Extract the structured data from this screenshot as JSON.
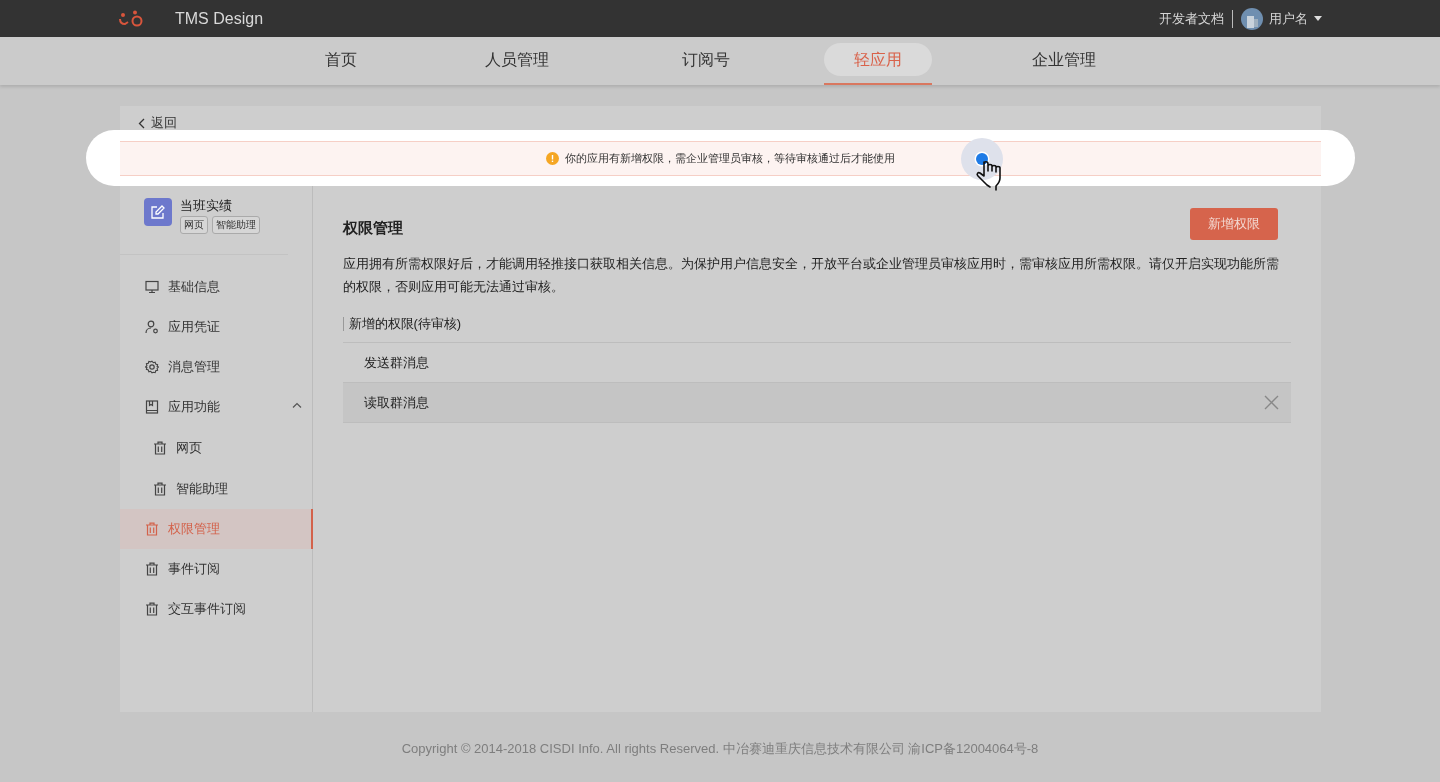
{
  "header": {
    "brand": "TMS Design",
    "docs_link": "开发者文档",
    "username": "用户名"
  },
  "nav": [
    {
      "label": "首页",
      "selected": false
    },
    {
      "label": "人员管理",
      "selected": false
    },
    {
      "label": "订阅号",
      "selected": false
    },
    {
      "label": "轻应用",
      "selected": true
    },
    {
      "label": "企业管理",
      "selected": false
    }
  ],
  "back": "返回",
  "notice": "你的应用有新增权限，需企业管理员审核，等待审核通过后才能使用",
  "app_card": {
    "name": "当班实绩",
    "tags": [
      "网页",
      "智能助理"
    ]
  },
  "sidebar": [
    {
      "label": "基础信息",
      "selected": false
    },
    {
      "label": "应用凭证",
      "selected": false
    },
    {
      "label": "消息管理",
      "selected": false
    },
    {
      "label": "应用功能",
      "selected": false,
      "expanded": true,
      "children": [
        {
          "label": "网页",
          "selected": false
        },
        {
          "label": "智能助理",
          "selected": false
        }
      ]
    },
    {
      "label": "权限管理",
      "selected": true
    },
    {
      "label": "事件订阅",
      "selected": false
    },
    {
      "label": "交互事件订阅",
      "selected": false
    }
  ],
  "content": {
    "title": "权限管理",
    "add_button": "新增权限",
    "description": "应用拥有所需权限好后，才能调用轻推接口获取相关信息。为保护用户信息安全，开放平台或企业管理员审核应用时，需审核应用所需权限。请仅开启实现功能所需的权限，否则应用可能无法通过审核。",
    "section_title": "新增的权限(待审核)",
    "permissions": [
      {
        "label": "发送群消息",
        "hovered": false
      },
      {
        "label": "读取群消息",
        "hovered": true
      }
    ]
  },
  "footer": "Copyright © 2014-2018 CISDI Info. All rights Reserved. 中冶赛迪重庆信息技术有限公司 渝ICP备12004064号-8"
}
